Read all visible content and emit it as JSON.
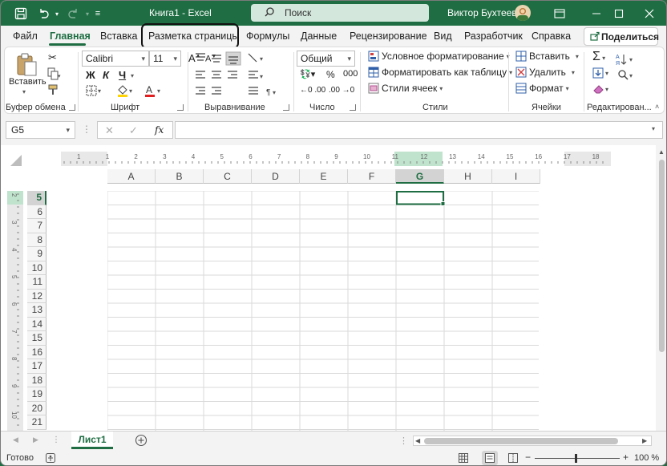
{
  "window": {
    "title": "Книга1  -  Excel",
    "search_placeholder": "Поиск",
    "user_name": "Виктор Бухтеев",
    "accent": "#1f6e43"
  },
  "tabs": [
    {
      "label": "Файл"
    },
    {
      "label": "Главная",
      "active": true
    },
    {
      "label": "Вставка"
    },
    {
      "label": "Разметка страницы",
      "highlighted": true
    },
    {
      "label": "Формулы"
    },
    {
      "label": "Данные"
    },
    {
      "label": "Рецензирование"
    },
    {
      "label": "Вид"
    },
    {
      "label": "Разработчик"
    },
    {
      "label": "Справка"
    }
  ],
  "share_label": "Поделиться",
  "ribbon": {
    "clipboard": {
      "paste_label": "Вставить",
      "group_label": "Буфер обмена"
    },
    "font": {
      "name": "Calibri",
      "size": "11",
      "bold": "Ж",
      "italic": "К",
      "underline": "Ч",
      "group_label": "Шрифт"
    },
    "alignment": {
      "group_label": "Выравнивание"
    },
    "number": {
      "format": "Общий",
      "group_label": "Число"
    },
    "styles": {
      "conditional": "Условное форматирование",
      "format_table": "Форматировать как таблицу",
      "cell_styles": "Стили ячеек",
      "group_label": "Стили"
    },
    "cells": {
      "insert": "Вставить",
      "delete": "Удалить",
      "format": "Формат",
      "group_label": "Ячейки"
    },
    "editing": {
      "group_label": "Редактирован..."
    }
  },
  "formula_bar": {
    "name_box": "G5",
    "formula": ""
  },
  "columns": [
    "A",
    "B",
    "C",
    "D",
    "E",
    "F",
    "G",
    "H",
    "I"
  ],
  "selected_column": "G",
  "rows": [
    "5",
    "6",
    "7",
    "8",
    "9",
    "10",
    "11",
    "12",
    "13",
    "14",
    "15",
    "16",
    "17",
    "18",
    "19",
    "20",
    "21"
  ],
  "selected_row": "5",
  "ruler_h": [
    "1",
    "1",
    "2",
    "3",
    "4",
    "5",
    "6",
    "7",
    "8",
    "9",
    "10",
    "11",
    "12",
    "13",
    "14",
    "15",
    "16",
    "17",
    "18"
  ],
  "ruler_v": [
    "2",
    "3",
    "4",
    "5",
    "6",
    "7",
    "8",
    "9",
    "10"
  ],
  "sheet_tabs": [
    {
      "label": "Лист1"
    }
  ],
  "status": {
    "ready": "Готово",
    "zoom": "100 %"
  }
}
